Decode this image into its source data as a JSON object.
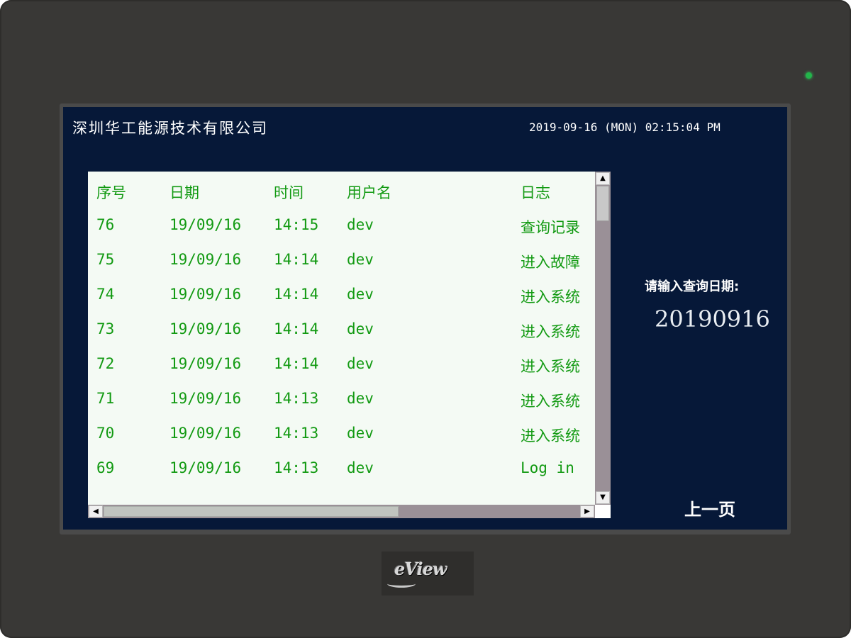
{
  "header": {
    "company": "深圳华工能源技术有限公司",
    "datetime": "2019-09-16 (MON) 02:15:04 PM"
  },
  "table": {
    "columns": [
      "序号",
      "日期",
      "时间",
      "用户名",
      "日志"
    ],
    "rows": [
      {
        "no": "76",
        "date": "19/09/16",
        "time": "14:15",
        "user": "dev",
        "log": "查询记录"
      },
      {
        "no": "75",
        "date": "19/09/16",
        "time": "14:14",
        "user": "dev",
        "log": "进入故障"
      },
      {
        "no": "74",
        "date": "19/09/16",
        "time": "14:14",
        "user": "dev",
        "log": "进入系统"
      },
      {
        "no": "73",
        "date": "19/09/16",
        "time": "14:14",
        "user": "dev",
        "log": "进入系统"
      },
      {
        "no": "72",
        "date": "19/09/16",
        "time": "14:14",
        "user": "dev",
        "log": "进入系统"
      },
      {
        "no": "71",
        "date": "19/09/16",
        "time": "14:13",
        "user": "dev",
        "log": "进入系统"
      },
      {
        "no": "70",
        "date": "19/09/16",
        "time": "14:13",
        "user": "dev",
        "log": "进入系统"
      },
      {
        "no": "69",
        "date": "19/09/16",
        "time": "14:13",
        "user": "dev",
        "log": "Log in"
      }
    ]
  },
  "query": {
    "label": "请输入查询日期:",
    "value": "20190916"
  },
  "nav": {
    "prev_label": "上一页"
  },
  "brand": {
    "logo_text": "eView"
  },
  "colors": {
    "screen_bg": "#061838",
    "table_text": "#129a12",
    "bezel": "#393836",
    "led": "#22b54a"
  },
  "icons": {
    "scroll_up": "▲",
    "scroll_down": "▼",
    "scroll_left": "◀",
    "scroll_right": "▶"
  }
}
